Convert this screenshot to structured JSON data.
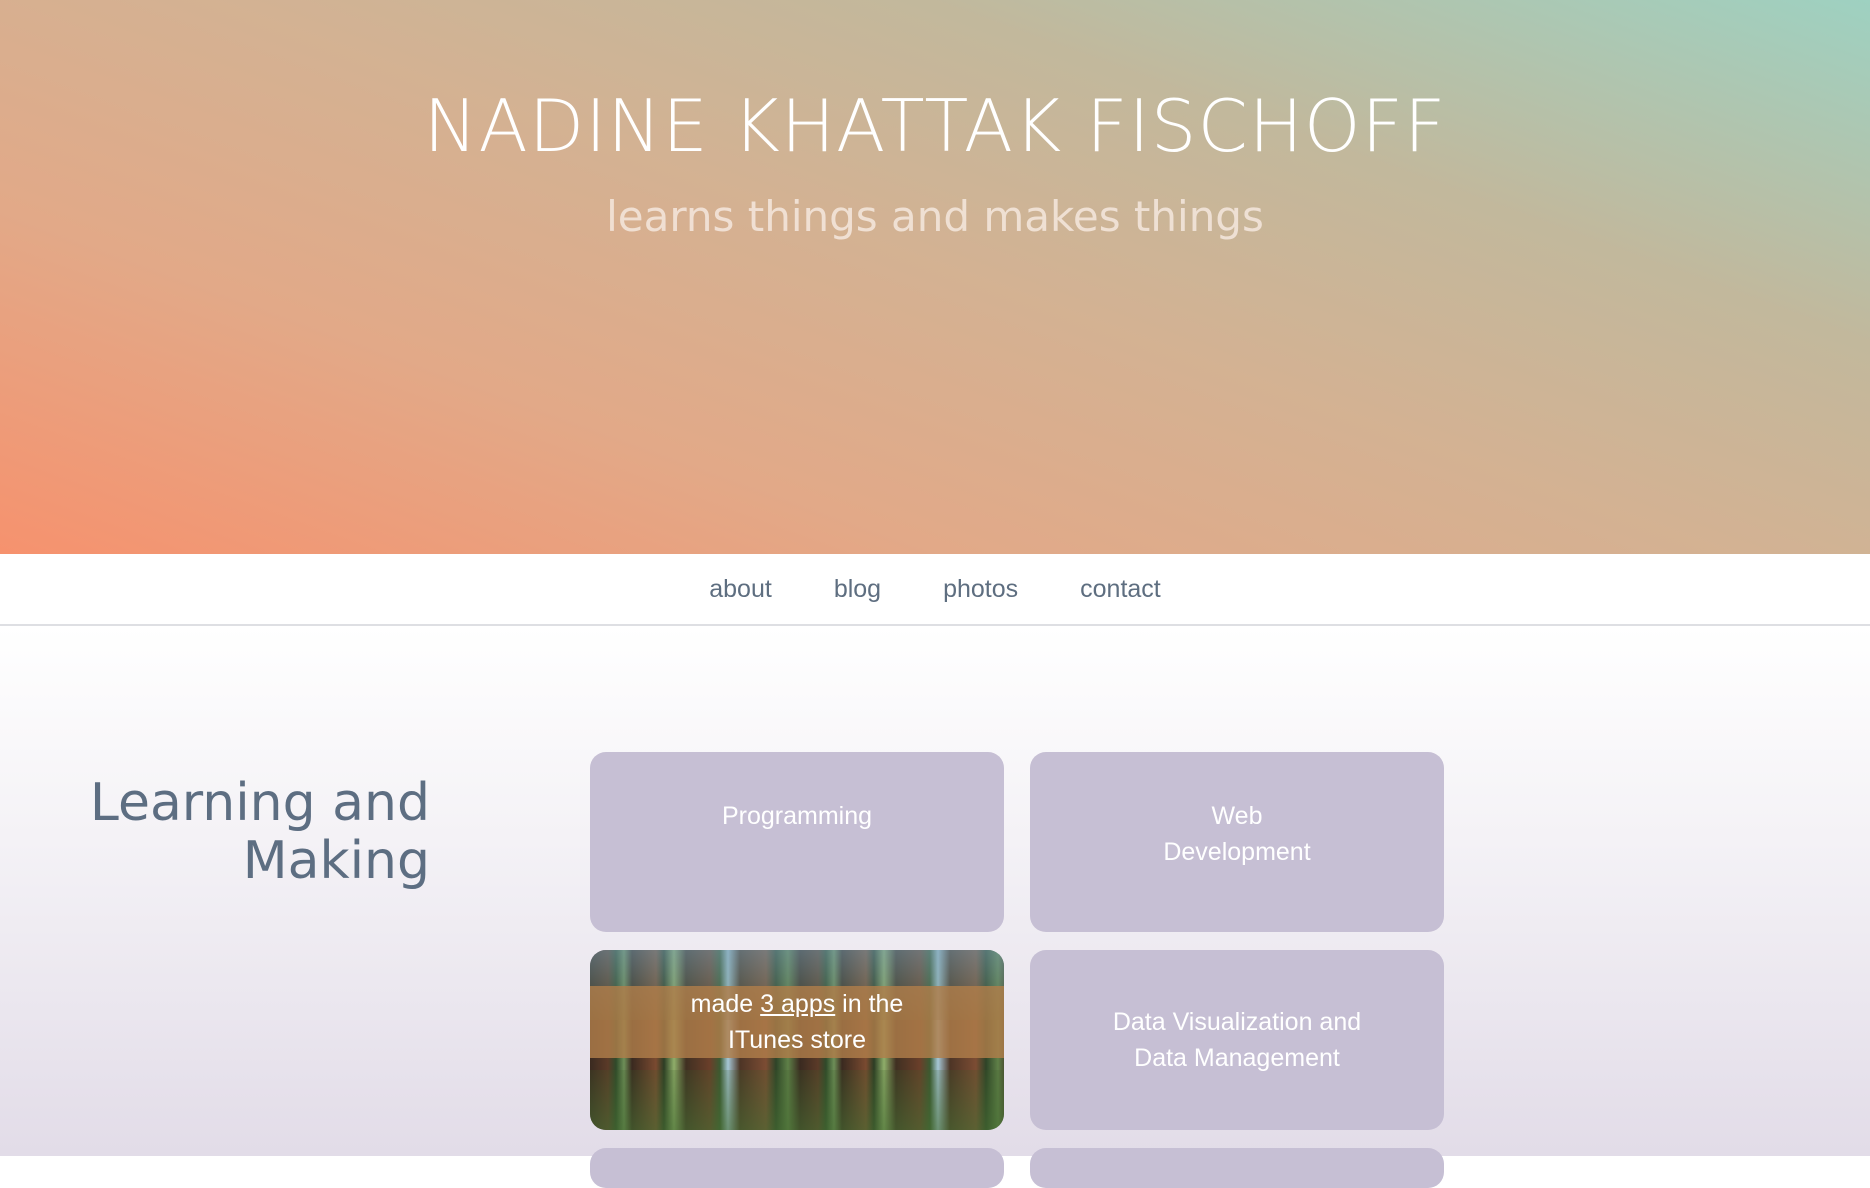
{
  "hero": {
    "title": "NADINE KHATTAK FISCHOFF",
    "subtitle": "learns things and makes things"
  },
  "nav": {
    "items": [
      {
        "label": "about"
      },
      {
        "label": "blog"
      },
      {
        "label": "photos"
      },
      {
        "label": "contact"
      }
    ]
  },
  "section": {
    "heading_line1": "Learning and",
    "heading_line2": "Making"
  },
  "cards": {
    "programming": {
      "label": "Programming"
    },
    "web_dev": {
      "line1": "Web",
      "line2": "Development"
    },
    "apps": {
      "prefix": "made ",
      "link": "3 apps",
      "suffix": " in the",
      "line2": "ITunes store"
    },
    "data_viz": {
      "line1": "Data Visualization and",
      "line2": "Data Management"
    }
  },
  "colors": {
    "hero_gradient_start": "#f6926e",
    "hero_gradient_end": "#9ed1c1",
    "nav_text": "#5e6e80",
    "heading_text": "#5d6e82",
    "card_bg": "#c6bfd4",
    "card_text": "#ffffff",
    "apps_band": "#b07e4a"
  }
}
